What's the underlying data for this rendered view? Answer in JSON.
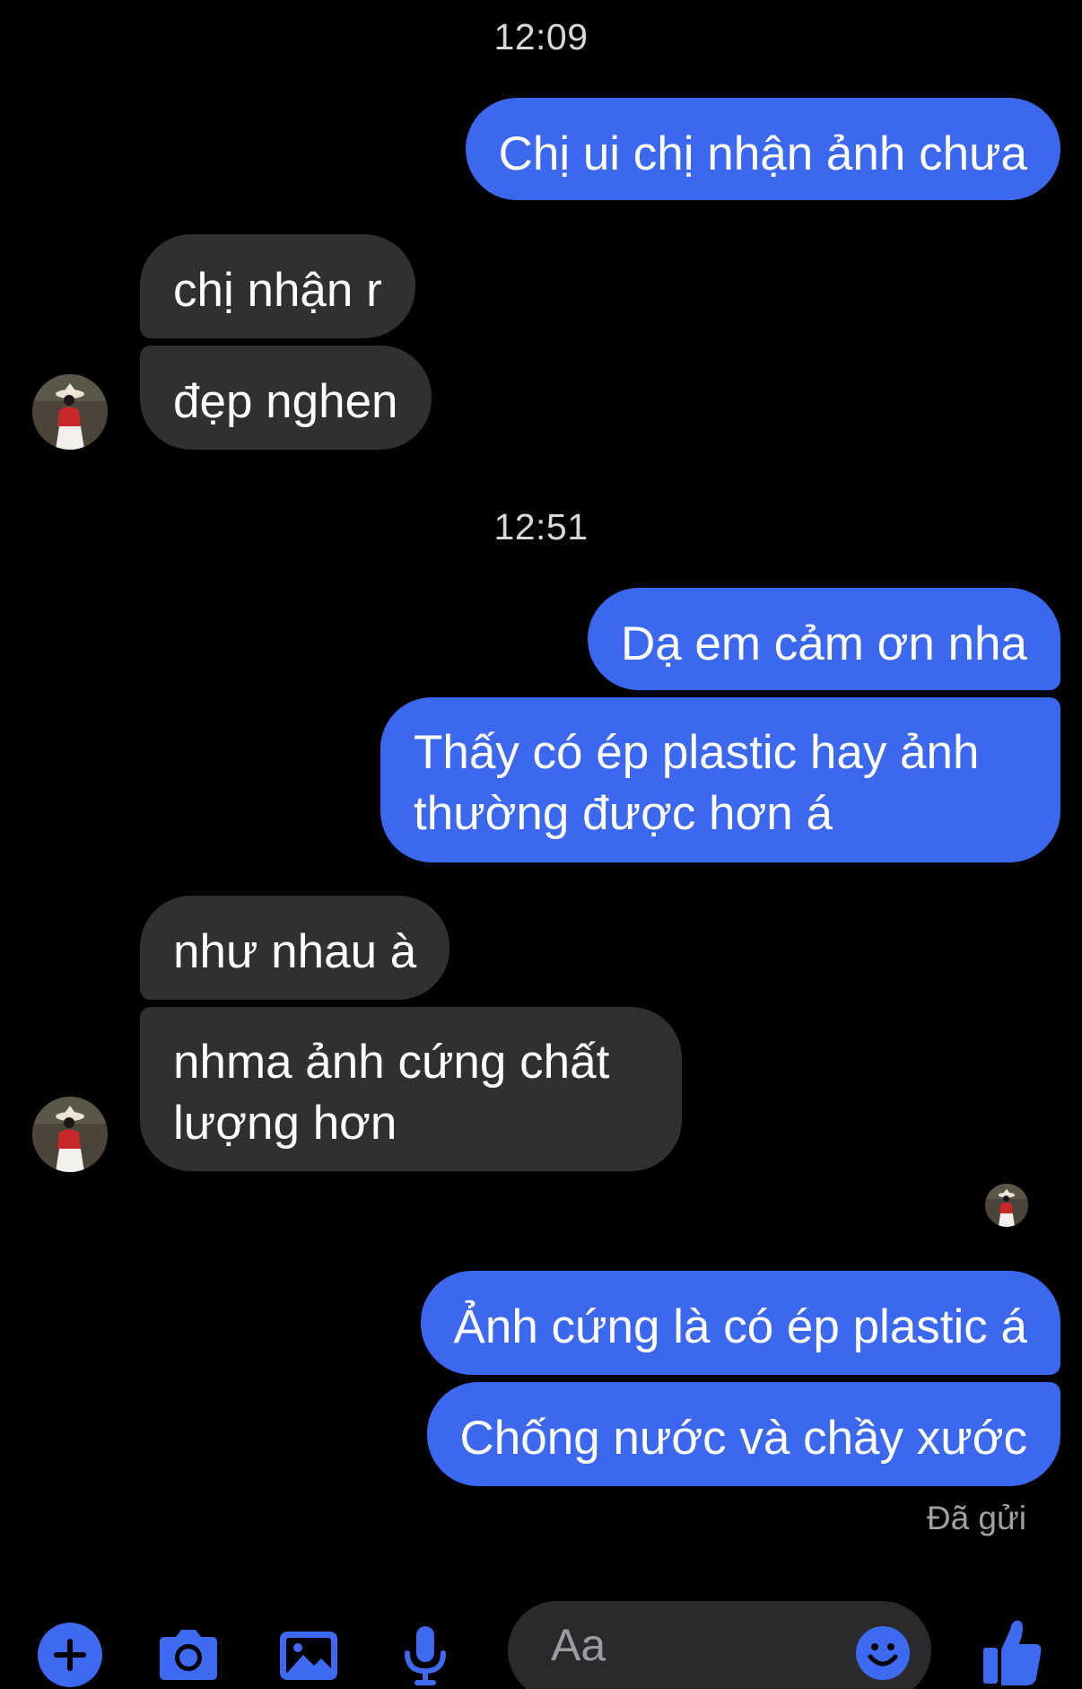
{
  "colors": {
    "background": "#000000",
    "outgoing_bubble": "#3c68f0",
    "incoming_bubble": "#303033",
    "accent": "#3e6af2",
    "timestamp": "#d8d8dc",
    "status": "#a0a0a5"
  },
  "conversation": {
    "timestamps": [
      "12:09",
      "12:51"
    ],
    "messages": [
      {
        "from": "me",
        "text": "Chị ui chị nhận ảnh chưa"
      },
      {
        "from": "contact",
        "text": "chị nhận r"
      },
      {
        "from": "contact",
        "text": "đẹp nghen"
      },
      {
        "from": "me",
        "text": "Dạ em cảm ơn nha"
      },
      {
        "from": "me",
        "text": "Thấy có ép plastic hay ảnh thường được hơn á"
      },
      {
        "from": "contact",
        "text": "như nhau à"
      },
      {
        "from": "contact",
        "text": "nhma ảnh cứng chất lượng hơn"
      },
      {
        "from": "me",
        "text": "Ảnh cứng là có ép plastic á"
      },
      {
        "from": "me",
        "text": "Chống nước và chầy xước"
      }
    ],
    "status": "Đã gửi"
  },
  "composer": {
    "placeholder": "Aa",
    "icons": [
      "plus-icon",
      "camera-icon",
      "image-icon",
      "microphone-icon",
      "emoji-icon",
      "thumbs-up-icon"
    ]
  }
}
